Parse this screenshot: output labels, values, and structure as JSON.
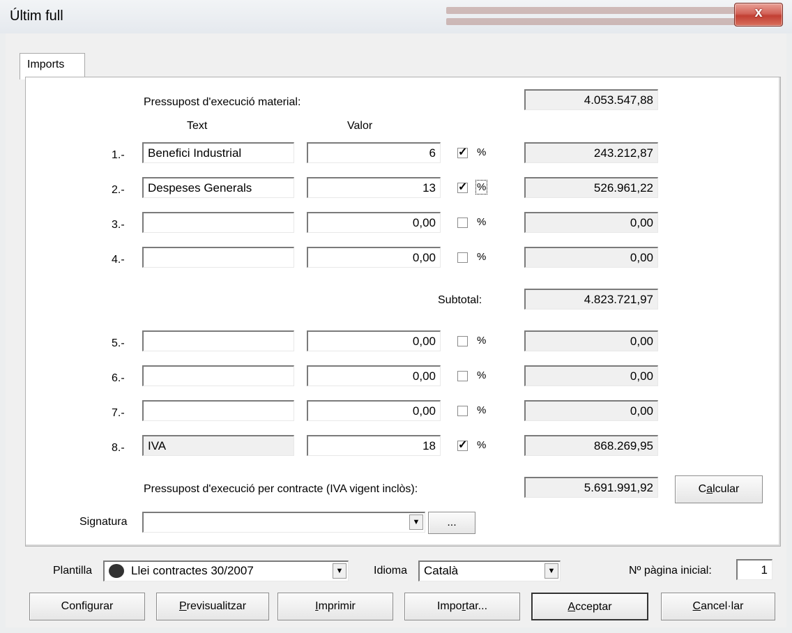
{
  "window": {
    "title": "Últim full",
    "close_label": "x"
  },
  "tab": {
    "label": "Imports"
  },
  "pem": {
    "label": "Pressupost d'execució material:",
    "value": "4.053.547,88"
  },
  "headers": {
    "text": "Text",
    "valor": "Valor"
  },
  "rows": [
    {
      "num": "1.-",
      "text": "Benefici Industrial",
      "valor": "6",
      "checked": true,
      "pct": "%",
      "result": "243.212,87"
    },
    {
      "num": "2.-",
      "text": "Despeses Generals",
      "valor": "13",
      "checked": true,
      "pct": "%",
      "result": "526.961,22"
    },
    {
      "num": "3.-",
      "text": "",
      "valor": "0,00",
      "checked": false,
      "pct": "%",
      "result": "0,00"
    },
    {
      "num": "4.-",
      "text": "",
      "valor": "0,00",
      "checked": false,
      "pct": "%",
      "result": "0,00"
    },
    {
      "num": "5.-",
      "text": "",
      "valor": "0,00",
      "checked": false,
      "pct": "%",
      "result": "0,00"
    },
    {
      "num": "6.-",
      "text": "",
      "valor": "0,00",
      "checked": false,
      "pct": "%",
      "result": "0,00"
    },
    {
      "num": "7.-",
      "text": "",
      "valor": "0,00",
      "checked": false,
      "pct": "%",
      "result": "0,00"
    },
    {
      "num": "8.-",
      "text": "IVA",
      "valor": "18",
      "checked": true,
      "pct": "%",
      "result": "868.269,95"
    }
  ],
  "subtotal": {
    "label": "Subtotal:",
    "value": "4.823.721,97"
  },
  "contract": {
    "label": "Pressupost d'execució per contracte (IVA vigent inclòs):",
    "value": "5.691.991,92"
  },
  "calcular": {
    "pre": "C",
    "accel": "a",
    "post": "lcular"
  },
  "signatura": {
    "label": "Signatura",
    "value": "",
    "browse_label": "..."
  },
  "plantilla": {
    "label": "Plantilla",
    "value": "Llei contractes 30/2007"
  },
  "idioma": {
    "label": "Idioma",
    "value": "Català"
  },
  "pagina": {
    "label": "Nº pàgina inicial:",
    "value": "1"
  },
  "buttons": {
    "configurar": "Configurar",
    "previsualitzar": {
      "accel": "P",
      "post": "revisualitzar"
    },
    "imprimir": {
      "accel": "I",
      "post": "mprimir"
    },
    "importar": {
      "pre": "Impo",
      "accel": "r",
      "post": "tar..."
    },
    "acceptar": {
      "accel": "A",
      "post": "cceptar"
    },
    "cancellar": {
      "accel": "C",
      "post": "ancel·lar"
    }
  }
}
